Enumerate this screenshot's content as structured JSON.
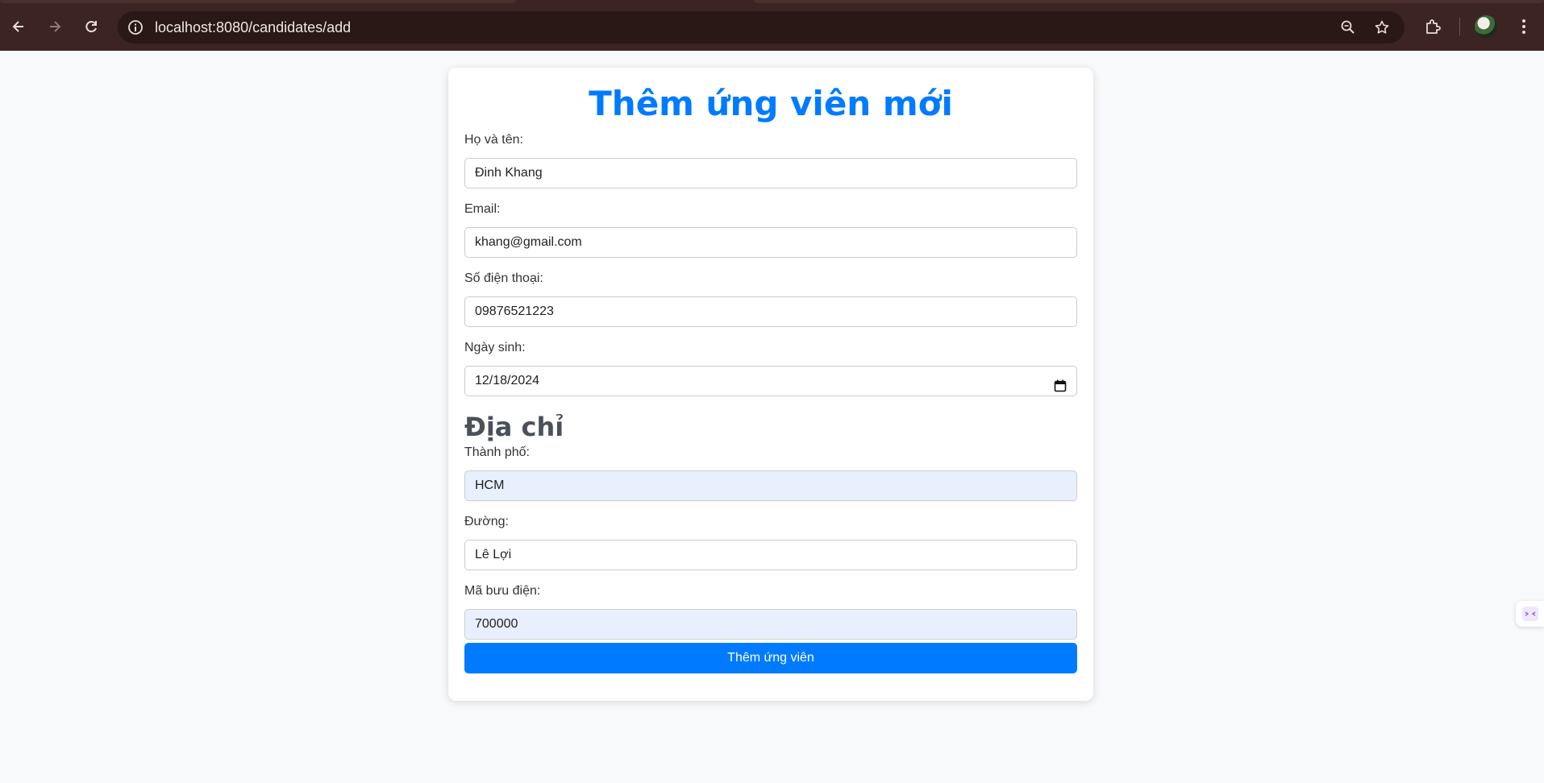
{
  "browser": {
    "url": "localhost:8080/candidates/add",
    "icons": [
      "back-arrow-icon",
      "forward-arrow-icon",
      "reload-icon",
      "site-info-icon",
      "zoom-icon",
      "bookmark-star-icon",
      "extensions-icon",
      "profile-avatar",
      "more-menu-icon"
    ]
  },
  "form": {
    "title": "Thêm ứng viên mới",
    "name_label": "Họ và tên:",
    "name_value": "Đinh Khang",
    "email_label": "Email:",
    "email_value": "khang@gmail.com",
    "phone_label": "Số điện thoại:",
    "phone_value": "09876521223",
    "dob_label": "Ngày sinh:",
    "dob_value": "12/18/2024",
    "address_heading": "Địa chỉ",
    "city_label": "Thành phố:",
    "city_value": "HCM",
    "street_label": "Đường:",
    "street_value": "Lê Lợi",
    "zip_label": "Mã bưu điện:",
    "zip_value": "700000",
    "submit_label": "Thêm ứng viên"
  },
  "colors": {
    "accent": "#007bff",
    "chrome": "#3b2422",
    "autofill": "#e8f0fe",
    "page_bg": "#f8f9fa"
  }
}
